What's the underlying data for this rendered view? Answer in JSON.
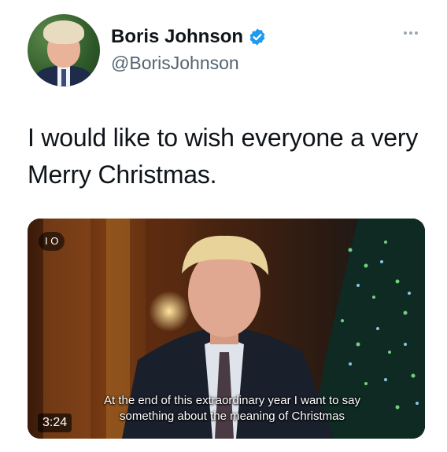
{
  "author": {
    "display_name": "Boris Johnson",
    "handle": "@BorisJohnson",
    "verified": true,
    "verified_color": "#1d9bf0"
  },
  "more_icon": "more-horizontal-icon",
  "tweet": {
    "text": "I would like to wish everyone a very Merry Christmas."
  },
  "media": {
    "badge": "I O",
    "duration": "3:24",
    "caption": "At the end of this extraordinary year I want to say something about the meaning of Christmas"
  }
}
